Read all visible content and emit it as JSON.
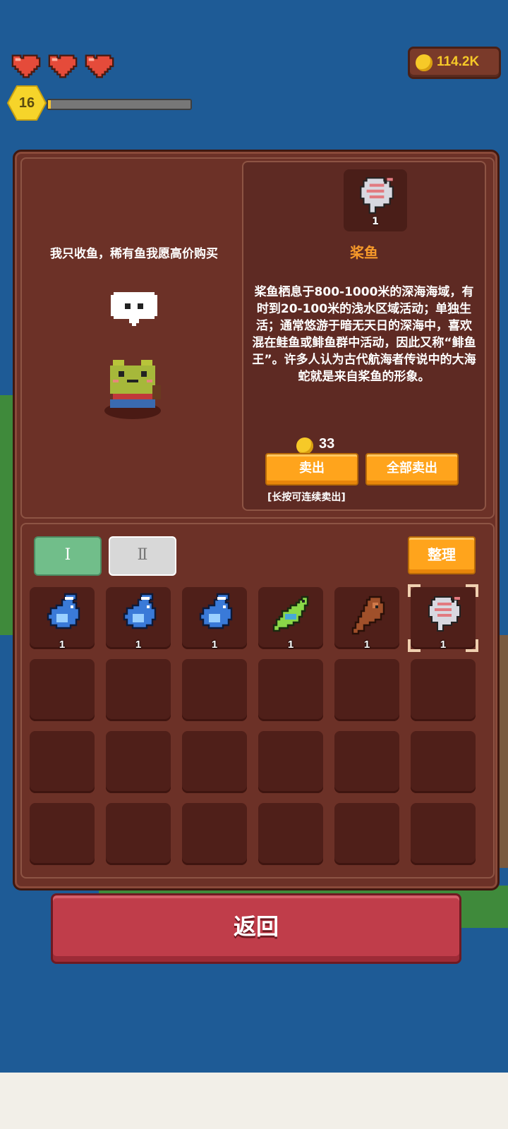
{
  "hud": {
    "hearts": 3,
    "level": "16",
    "xp_progress": 0.02,
    "coins": "114.2K"
  },
  "npc": {
    "speech": "我只收鱼，稀有鱼我愿高价购买"
  },
  "item_detail": {
    "quantity": "1",
    "name": "桨鱼",
    "description": "桨鱼栖息于800-1000米的深海海域，有时到20-100米的浅水区域活动；单独生活；通常悠游于暗无天日的深海中，喜欢混在鲑鱼或鲱鱼群中活动，因此又称“鲱鱼王”。许多人认为古代航海者传说中的大海蛇就是来自桨鱼的形象。",
    "price": "33",
    "sell_label": "卖出",
    "sell_all_label": "全部卖出",
    "hint": "[长按可连续卖出]"
  },
  "inventory": {
    "tab1_label": "Ⅰ",
    "tab2_label": "Ⅱ",
    "sort_label": "整理",
    "slots": [
      {
        "icon": "blue-fish-icon",
        "qty": "1"
      },
      {
        "icon": "blue-fish-icon",
        "qty": "1"
      },
      {
        "icon": "blue-fish-icon",
        "qty": "1"
      },
      {
        "icon": "green-fish-icon",
        "qty": "1"
      },
      {
        "icon": "brown-fish-icon",
        "qty": "1"
      },
      {
        "icon": "oarfish-icon",
        "qty": "1",
        "selected": true
      }
    ]
  },
  "back_label": "返回",
  "colors": {
    "background": "#1e5b96",
    "panel": "#6c3127",
    "accent_orange": "#ffa41c",
    "back_button": "#c03d4a"
  }
}
